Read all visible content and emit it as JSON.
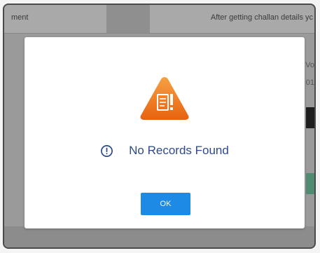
{
  "background": {
    "header_left_text": "ment",
    "header_right_text": "After getting challan details yc",
    "side_text_1": "Vo",
    "side_text_2": "01"
  },
  "dialog": {
    "message": "No Records Found",
    "ok_label": "OK",
    "icons": {
      "alert": "warning-document-icon",
      "info": "info-circle-icon"
    },
    "colors": {
      "accent": "#1d8ae6",
      "message_text": "#2e4a8c",
      "warning": "#f07a1a"
    }
  }
}
